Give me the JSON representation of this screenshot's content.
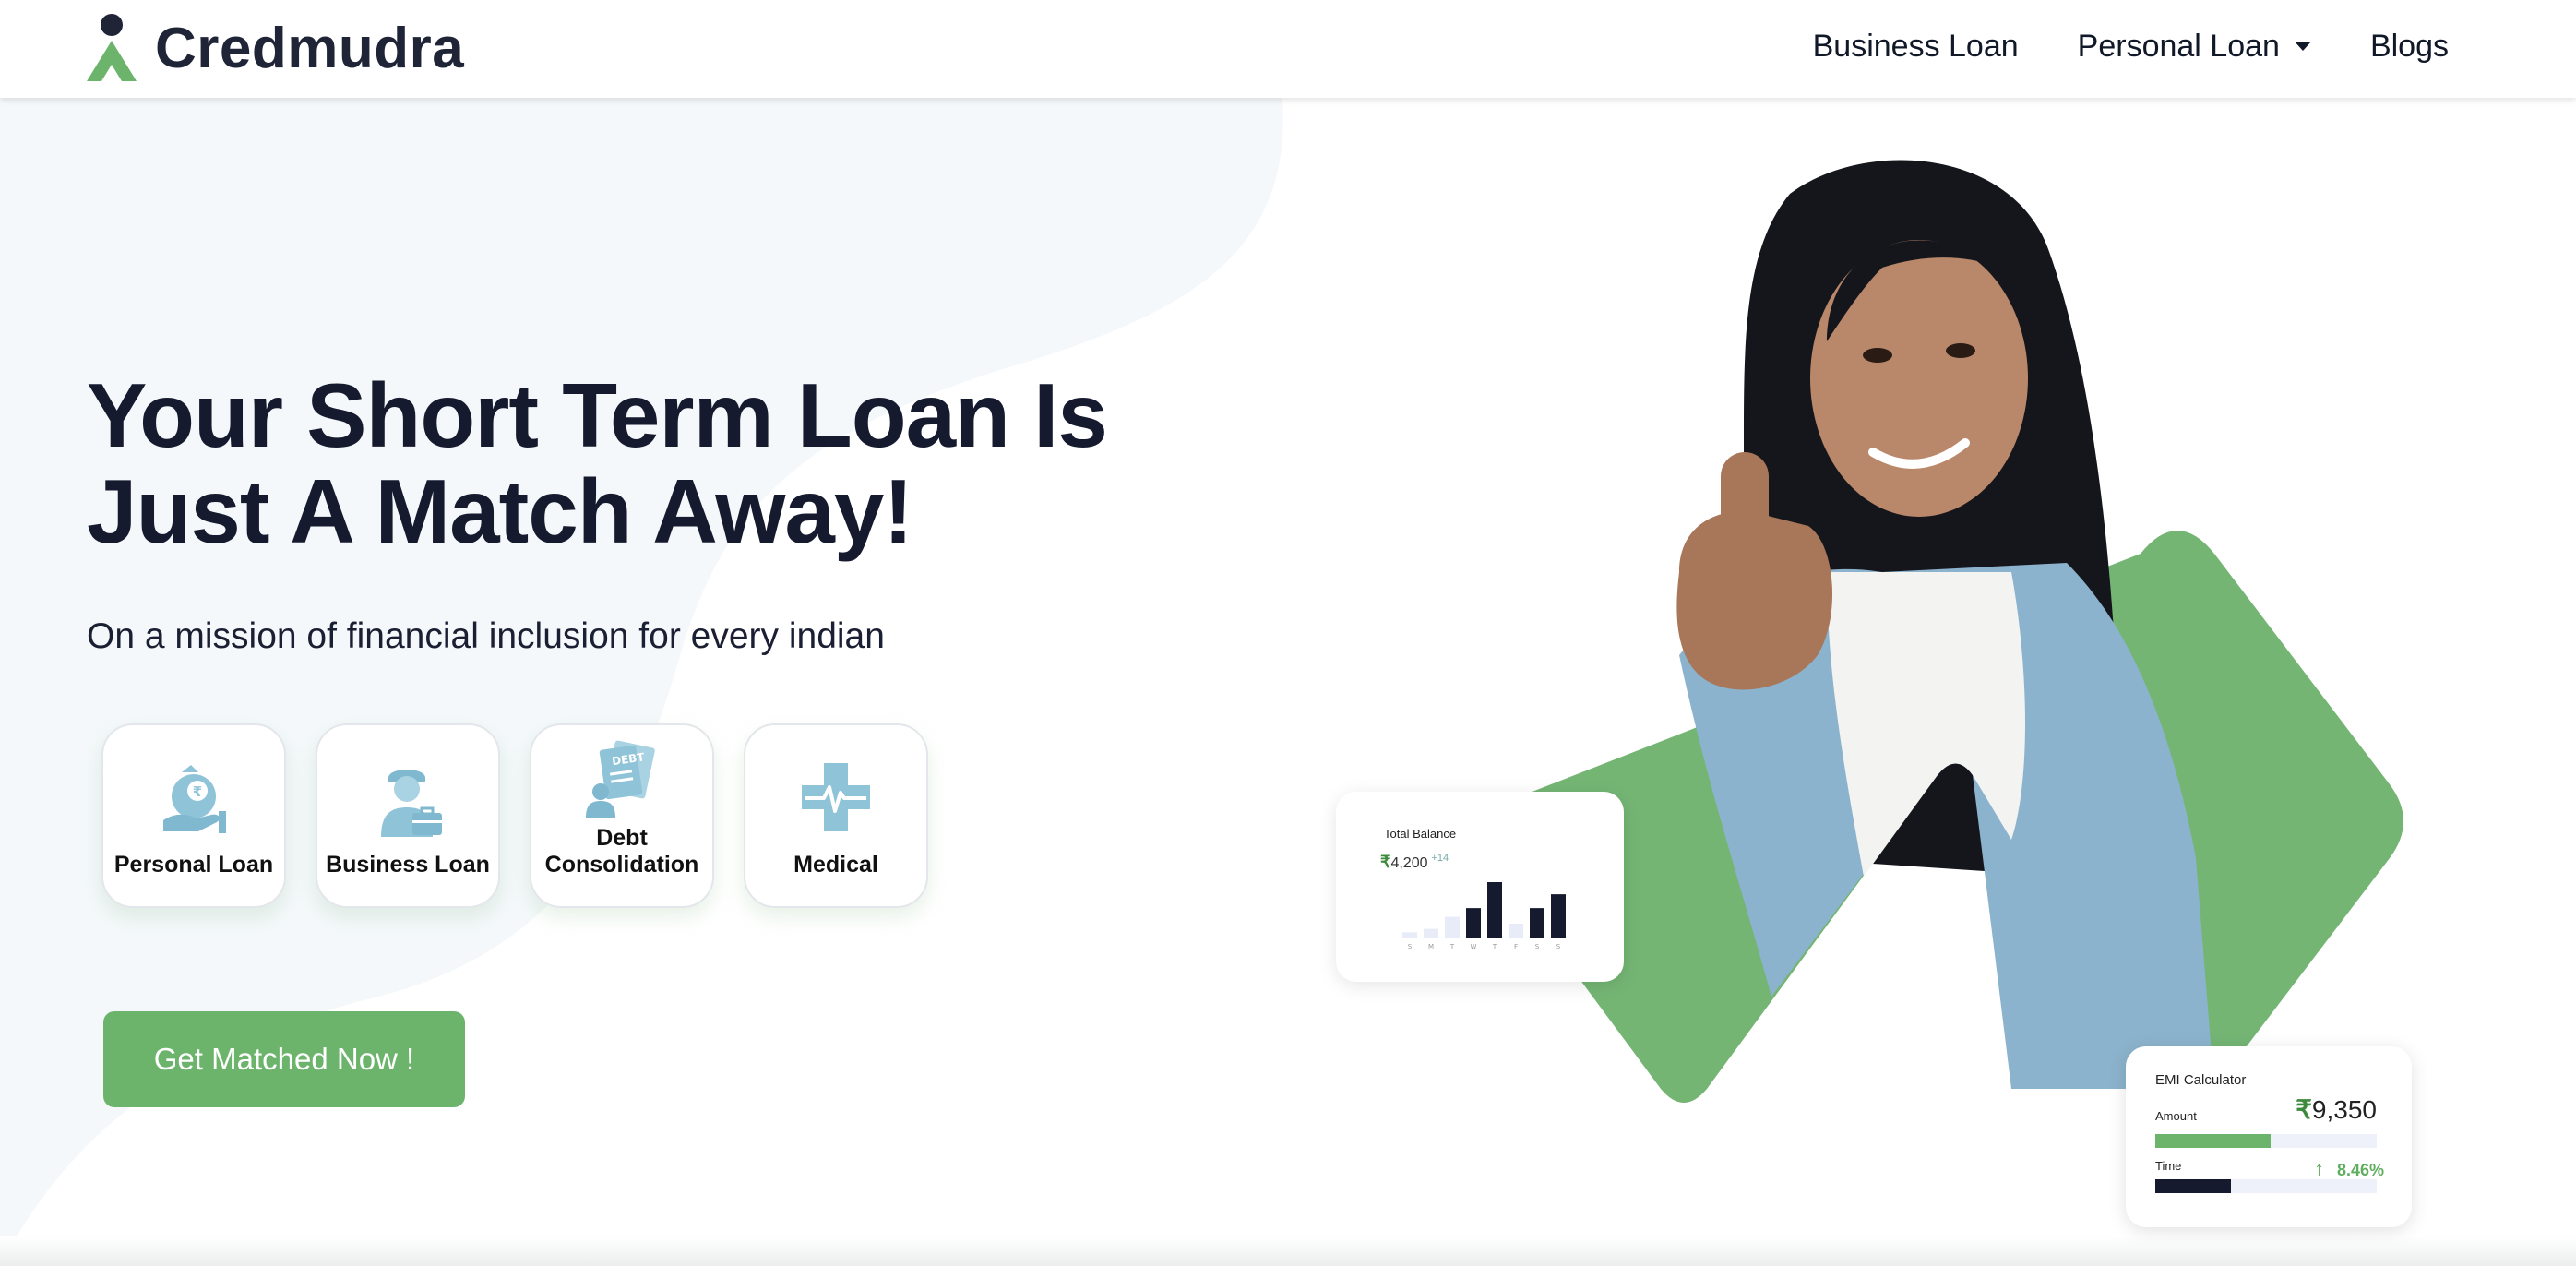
{
  "brand": {
    "name": "Credmudra",
    "primary_color": "#6cb46c",
    "dark_color": "#1f2437"
  },
  "nav": {
    "items": [
      {
        "label": "Business Loan"
      },
      {
        "label": "Personal Loan",
        "has_dropdown": true
      },
      {
        "label": "Blogs"
      }
    ]
  },
  "hero": {
    "title_line1": "Your Short Term Loan Is",
    "title_line2": "Just A Match Away!",
    "subtitle": "On a mission of financial inclusion for every indian",
    "cta_label": "Get Matched Now !"
  },
  "categories": [
    {
      "label": "Personal Loan",
      "icon": "money-bag-hand-icon"
    },
    {
      "label": "Business Loan",
      "icon": "businessman-briefcase-icon"
    },
    {
      "label_line1": "Debt",
      "label_line2": "Consolidation",
      "icon": "debt-document-icon"
    },
    {
      "label": "Medical",
      "icon": "medical-cross-icon"
    }
  ],
  "balance_widget": {
    "title": "Total Balance",
    "amount": "4,200",
    "delta": "+14",
    "currency": "₹",
    "days": [
      "S",
      "M",
      "T",
      "W",
      "T",
      "F",
      "S",
      "S"
    ],
    "bar_values": [
      3,
      5,
      12,
      17,
      32,
      8,
      17,
      25
    ]
  },
  "emi_widget": {
    "title": "EMI Calculator",
    "amount_label": "Amount",
    "currency": "₹",
    "amount": "9,350",
    "amount_progress": 0.52,
    "time_label": "Time",
    "rate": "8.46%",
    "time_progress": 0.34
  }
}
